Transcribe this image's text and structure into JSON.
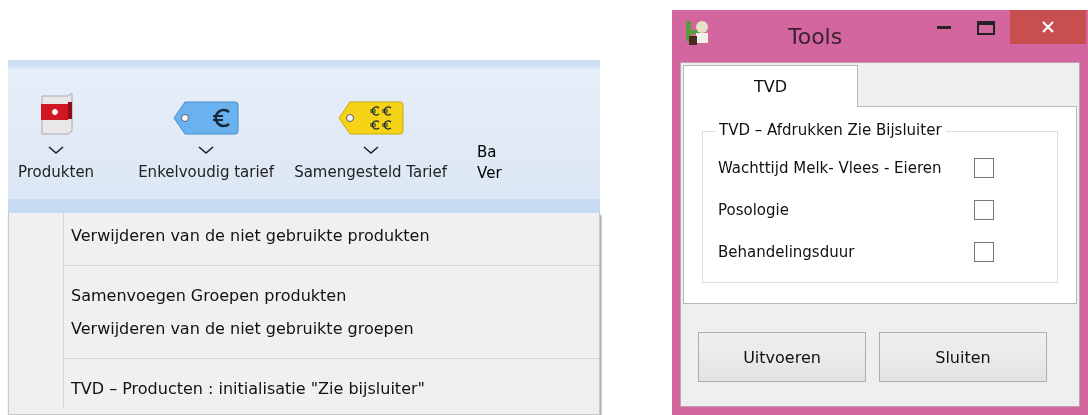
{
  "ribbon": {
    "buttons": [
      {
        "label": "Produkten",
        "kind": "box"
      },
      {
        "label": "Enkelvoudig tarief",
        "kind": "tag-single"
      },
      {
        "label": "Samengesteld Tarief",
        "kind": "tag-multi"
      },
      {
        "label": "Ba\nVer",
        "kind": "cut"
      }
    ]
  },
  "menu": {
    "groups": [
      [
        "Verwijderen van de niet gebruikte produkten"
      ],
      [
        "Samenvoegen Groepen produkten",
        "Verwijderen van de niet gebruikte groepen"
      ],
      [
        "TVD – Producten : initialisatie \"Zie bijsluiter\""
      ]
    ]
  },
  "dialog": {
    "title": "Tools",
    "tabs": [
      {
        "label": "TVD",
        "selected": true
      }
    ],
    "group": {
      "legend": "TVD – Afdrukken Zie Bijsluiter",
      "options": [
        {
          "label": "Wachttijd Melk- Vlees - Eieren",
          "checked": false
        },
        {
          "label": "Posologie",
          "checked": false
        },
        {
          "label": "Behandelingsduur",
          "checked": false
        }
      ]
    },
    "buttons": [
      "Uitvoeren",
      "Sluiten"
    ]
  }
}
